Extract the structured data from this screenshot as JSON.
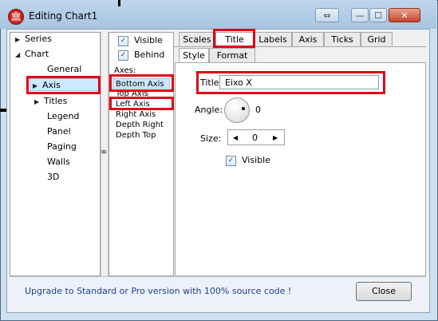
{
  "window": {
    "title": "Editing Chart1",
    "app_icon_glyph": "🏛"
  },
  "titlebar_buttons": {
    "resize_glyph": "⇔",
    "minimize_glyph": "—",
    "maximize_glyph": "☐",
    "close_glyph": "✕"
  },
  "tree": {
    "items": [
      {
        "label": "Series",
        "arrow": "▶"
      },
      {
        "label": "Chart",
        "arrow": "◢"
      },
      {
        "label": "General",
        "arrow": ""
      },
      {
        "label": "Axis",
        "arrow": "▶"
      },
      {
        "label": "Titles",
        "arrow": "▶"
      },
      {
        "label": "Legend",
        "arrow": ""
      },
      {
        "label": "Panel",
        "arrow": ""
      },
      {
        "label": "Paging",
        "arrow": ""
      },
      {
        "label": "Walls",
        "arrow": ""
      },
      {
        "label": "3D",
        "arrow": ""
      }
    ],
    "selected": "Axis"
  },
  "splitter_grip": "∞",
  "axes_panel": {
    "visible_label": "Visible",
    "visible_checked": "✓",
    "behind_label": "Behind",
    "behind_checked": "✓",
    "axes_caption": "Axes:",
    "axes": [
      "Bottom Axis",
      "Top Axis",
      "Left Axis",
      "Right Axis",
      "Depth Right",
      "Depth Top"
    ],
    "selected": "Bottom Axis"
  },
  "tabs": [
    "Scales",
    "Title",
    "Labels",
    "Axis",
    "Ticks",
    "Grid"
  ],
  "active_tab": "Title",
  "subtabs": [
    "Style",
    "Format"
  ],
  "active_subtab": "Style",
  "title_form": {
    "title_label": "Title:",
    "title_value": "Eixo X",
    "angle_label": "Angle:",
    "angle_value": "0",
    "size_label": "Size:",
    "size_value": "0",
    "size_decrement_glyph": "◀",
    "size_increment_glyph": "▶",
    "visible_label": "Visible",
    "visible_checked": "✓"
  },
  "footer": {
    "upgrade_text": "Upgrade to Standard or Pro version with 100% source code !",
    "close_label": "Close"
  },
  "colors": {
    "highlight_box": "#e0001a",
    "selection": "#cde8ff",
    "link": "#203e8f"
  }
}
